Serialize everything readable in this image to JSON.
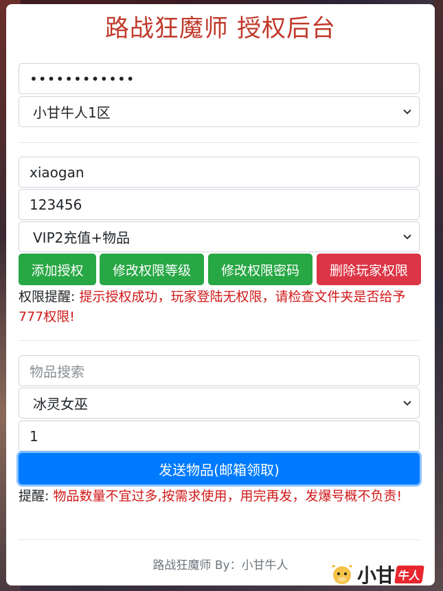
{
  "page": {
    "title": "路战狂魔师 授权后台"
  },
  "auth_section": {
    "password_value": "••••••••••••",
    "server_select": "小甘牛人1区"
  },
  "player_section": {
    "username_value": "xiaogan",
    "password_value": "123456",
    "permission_select": "VIP2充值+物品",
    "buttons": {
      "add": "添加授权",
      "modify_level": "修改权限等级",
      "modify_password": "修改权限密码",
      "delete": "删除玩家权限"
    },
    "notice_label": "权限提醒:",
    "notice_text": "提示授权成功，玩家登陆无权限，请检查文件夹是否给予777权限!"
  },
  "item_section": {
    "search_placeholder": "物品搜索",
    "item_select": "冰灵女巫",
    "quantity_value": "1",
    "send_button": "发送物品(邮箱领取)",
    "notice_label": "提醒:",
    "notice_text": "物品数量不宜过多,按需求使用，用完再发，发爆号概不负责!"
  },
  "footer": {
    "text": "路战狂魔师 By：小甘牛人"
  },
  "watermark": {
    "brand": "小甘",
    "tag": "牛人"
  },
  "colors": {
    "title": "#c0392b",
    "green": "#28a745",
    "red": "#dc3545",
    "blue": "#007bff",
    "warning_text": "#d01818"
  },
  "icons": {
    "select_arrow": "chevron-down-icon",
    "logo_mascot": "ox-mascot-icon"
  }
}
